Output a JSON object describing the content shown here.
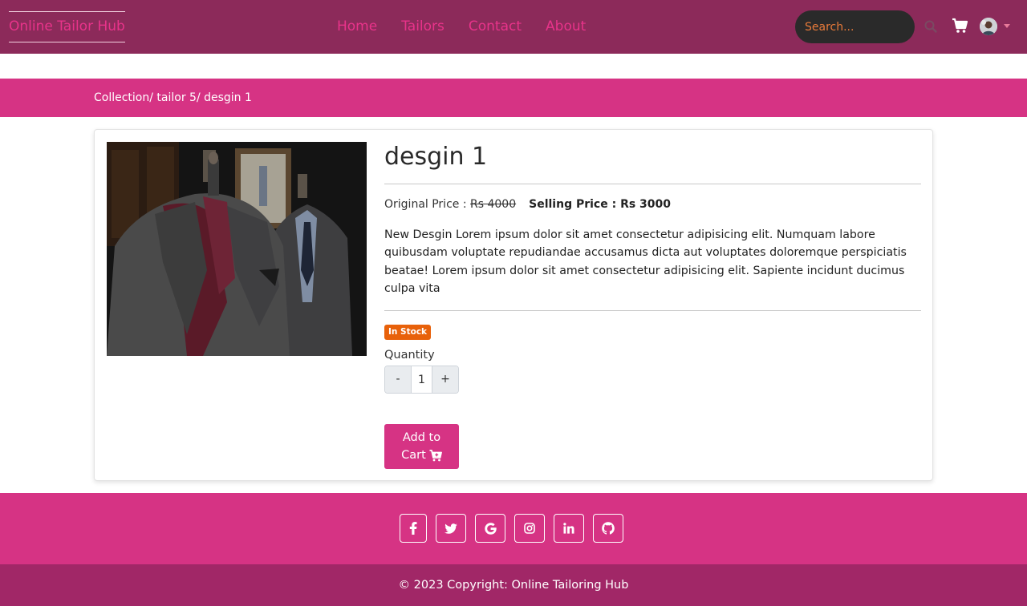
{
  "navbar": {
    "brand": "Online Tailor Hub",
    "links": [
      "Home",
      "Tailors",
      "Contact",
      "About"
    ],
    "search_placeholder": "Search..."
  },
  "breadcrumb": "Collection/ tailor 5/ desgin 1",
  "product": {
    "title": "desgin 1",
    "original_price_label": "Original Price : ",
    "original_price": "Rs 4000",
    "selling_price": "Selling Price : Rs 3000",
    "description": "New Desgin Lorem ipsum dolor sit amet consectetur adipisicing elit. Numquam labore quibusdam voluptate repudiandae accusamus dicta aut voluptates doloremque perspiciatis beatae! Lorem ipsum dolor sit amet consectetur adipisicing elit. Sapiente incidunt ducimus culpa vita",
    "stock_badge": "In Stock",
    "quantity_label": "Quantity",
    "quantity": "1",
    "minus": "-",
    "plus": "+",
    "add_to_cart_line1": "Add to",
    "add_to_cart_line2": "Cart"
  },
  "footer": {
    "socials": [
      "facebook-icon",
      "twitter-icon",
      "google-icon",
      "instagram-icon",
      "linkedin-icon",
      "github-icon"
    ],
    "copyright": "© 2023 Copyright: Online Tailoring Hub"
  },
  "colors": {
    "navbar": "#8c2a5a",
    "accent": "#d63384",
    "footer_bottom": "#a12767",
    "badge": "#e8610a",
    "brand_text": "#e8338a"
  }
}
